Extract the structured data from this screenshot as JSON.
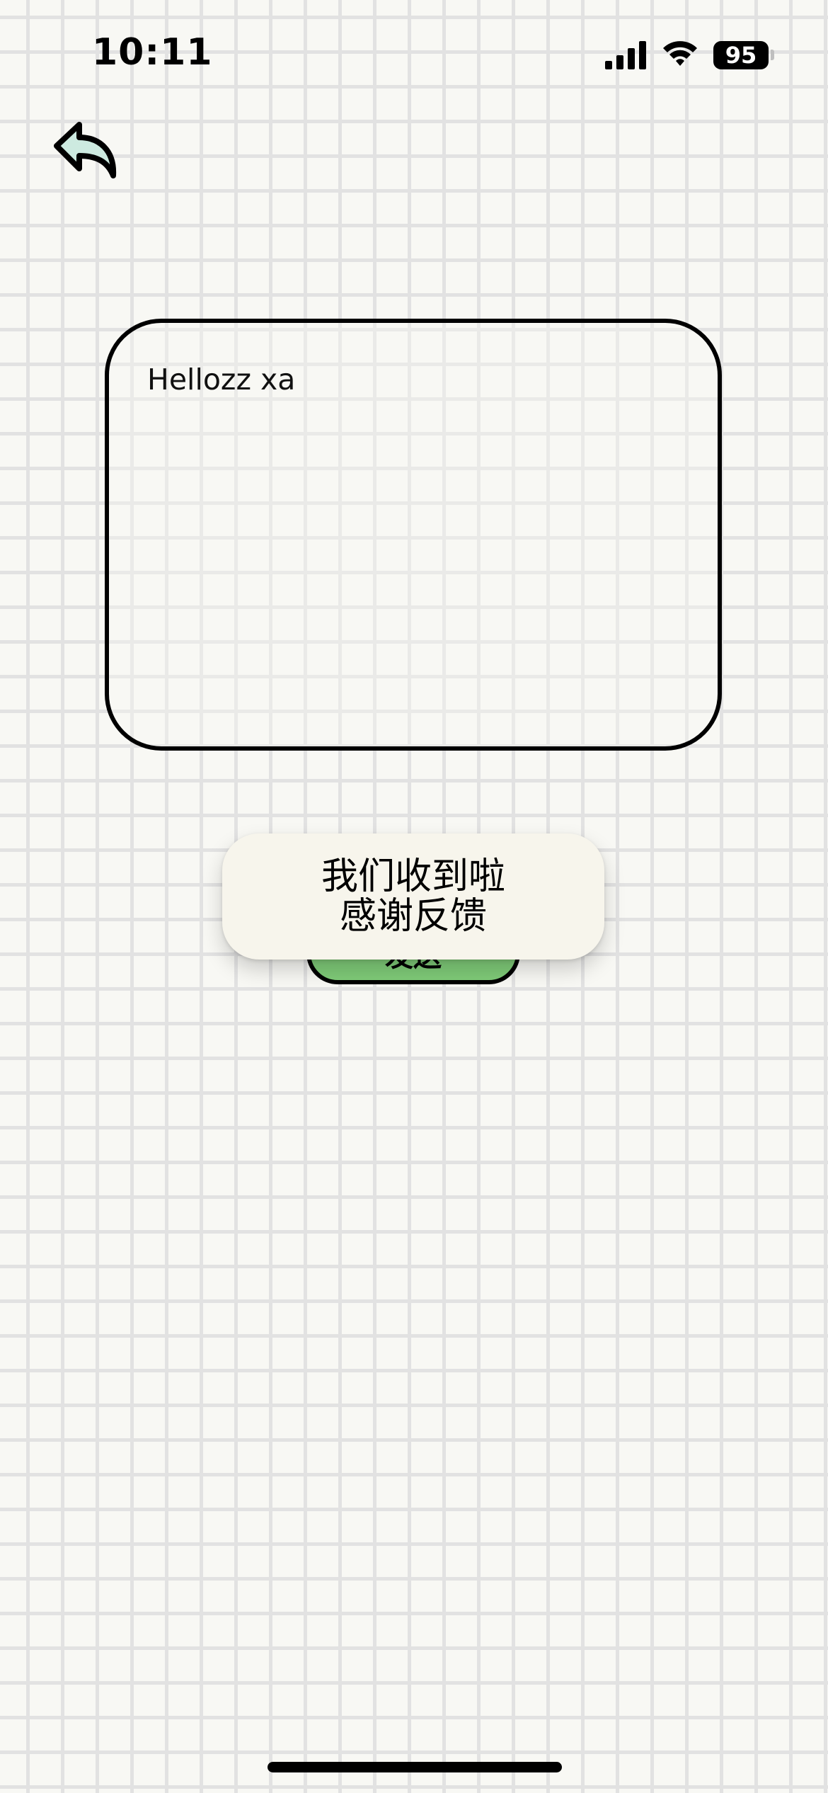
{
  "status_bar": {
    "time": "10:11",
    "battery_level": "95",
    "icons": [
      "signal-icon",
      "wifi-icon",
      "battery-icon"
    ]
  },
  "header": {
    "back_icon": "reply-arrow-icon"
  },
  "feedback": {
    "text": "Hellozz xa"
  },
  "actions": {
    "send_label": "发送"
  },
  "toast": {
    "line1": "我们收到啦",
    "line2": "感谢反馈"
  },
  "colors": {
    "background": "#f8f8f4",
    "grid": "#e2e2e2",
    "send_button": "#7fcb78",
    "toast_bg": "#f7f5ec",
    "back_icon_fill": "#cdeae0"
  }
}
